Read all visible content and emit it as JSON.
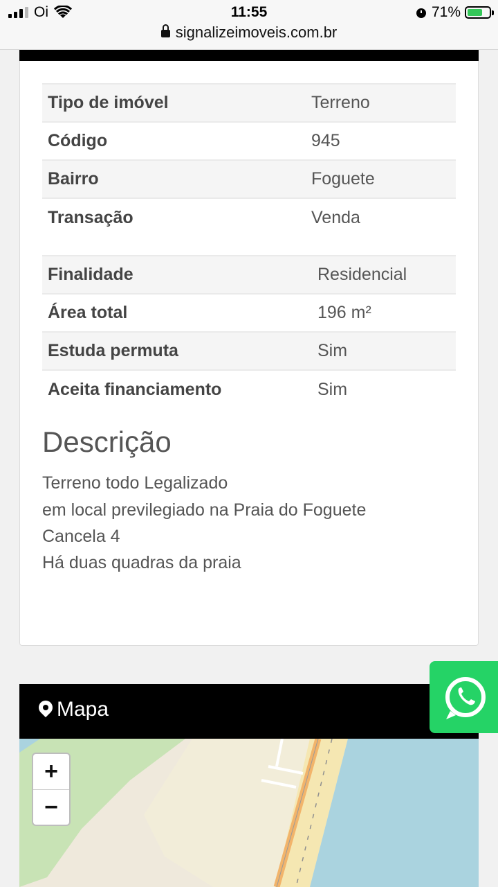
{
  "status_bar": {
    "carrier": "Oi",
    "time": "11:55",
    "battery": "71%",
    "battery_level": 0.71
  },
  "browser": {
    "url": "signalizeimoveis.com.br"
  },
  "details_main": [
    {
      "label": "Tipo de imóvel",
      "value": "Terreno"
    },
    {
      "label": "Código",
      "value": "945"
    },
    {
      "label": "Bairro",
      "value": "Foguete"
    },
    {
      "label": "Transação",
      "value": "Venda"
    }
  ],
  "details_extra": [
    {
      "label": "Finalidade",
      "value": "Residencial"
    },
    {
      "label": "Área total",
      "value": "196 m²"
    },
    {
      "label": "Estuda permuta",
      "value": "Sim"
    },
    {
      "label": "Aceita financiamento",
      "value": "Sim"
    }
  ],
  "description": {
    "title": "Descrição",
    "lines": [
      "Terreno todo Legalizado",
      "em local previlegiado na Praia do Foguete",
      "Cancela 4",
      "Há duas quadras da praia"
    ]
  },
  "map": {
    "title": "Mapa",
    "zoom_in": "+",
    "zoom_out": "−"
  },
  "colors": {
    "whatsapp": "#25d366",
    "header": "#000000",
    "water": "#aad3df",
    "beach": "#f5e7b2",
    "road": "#f2b46b"
  }
}
